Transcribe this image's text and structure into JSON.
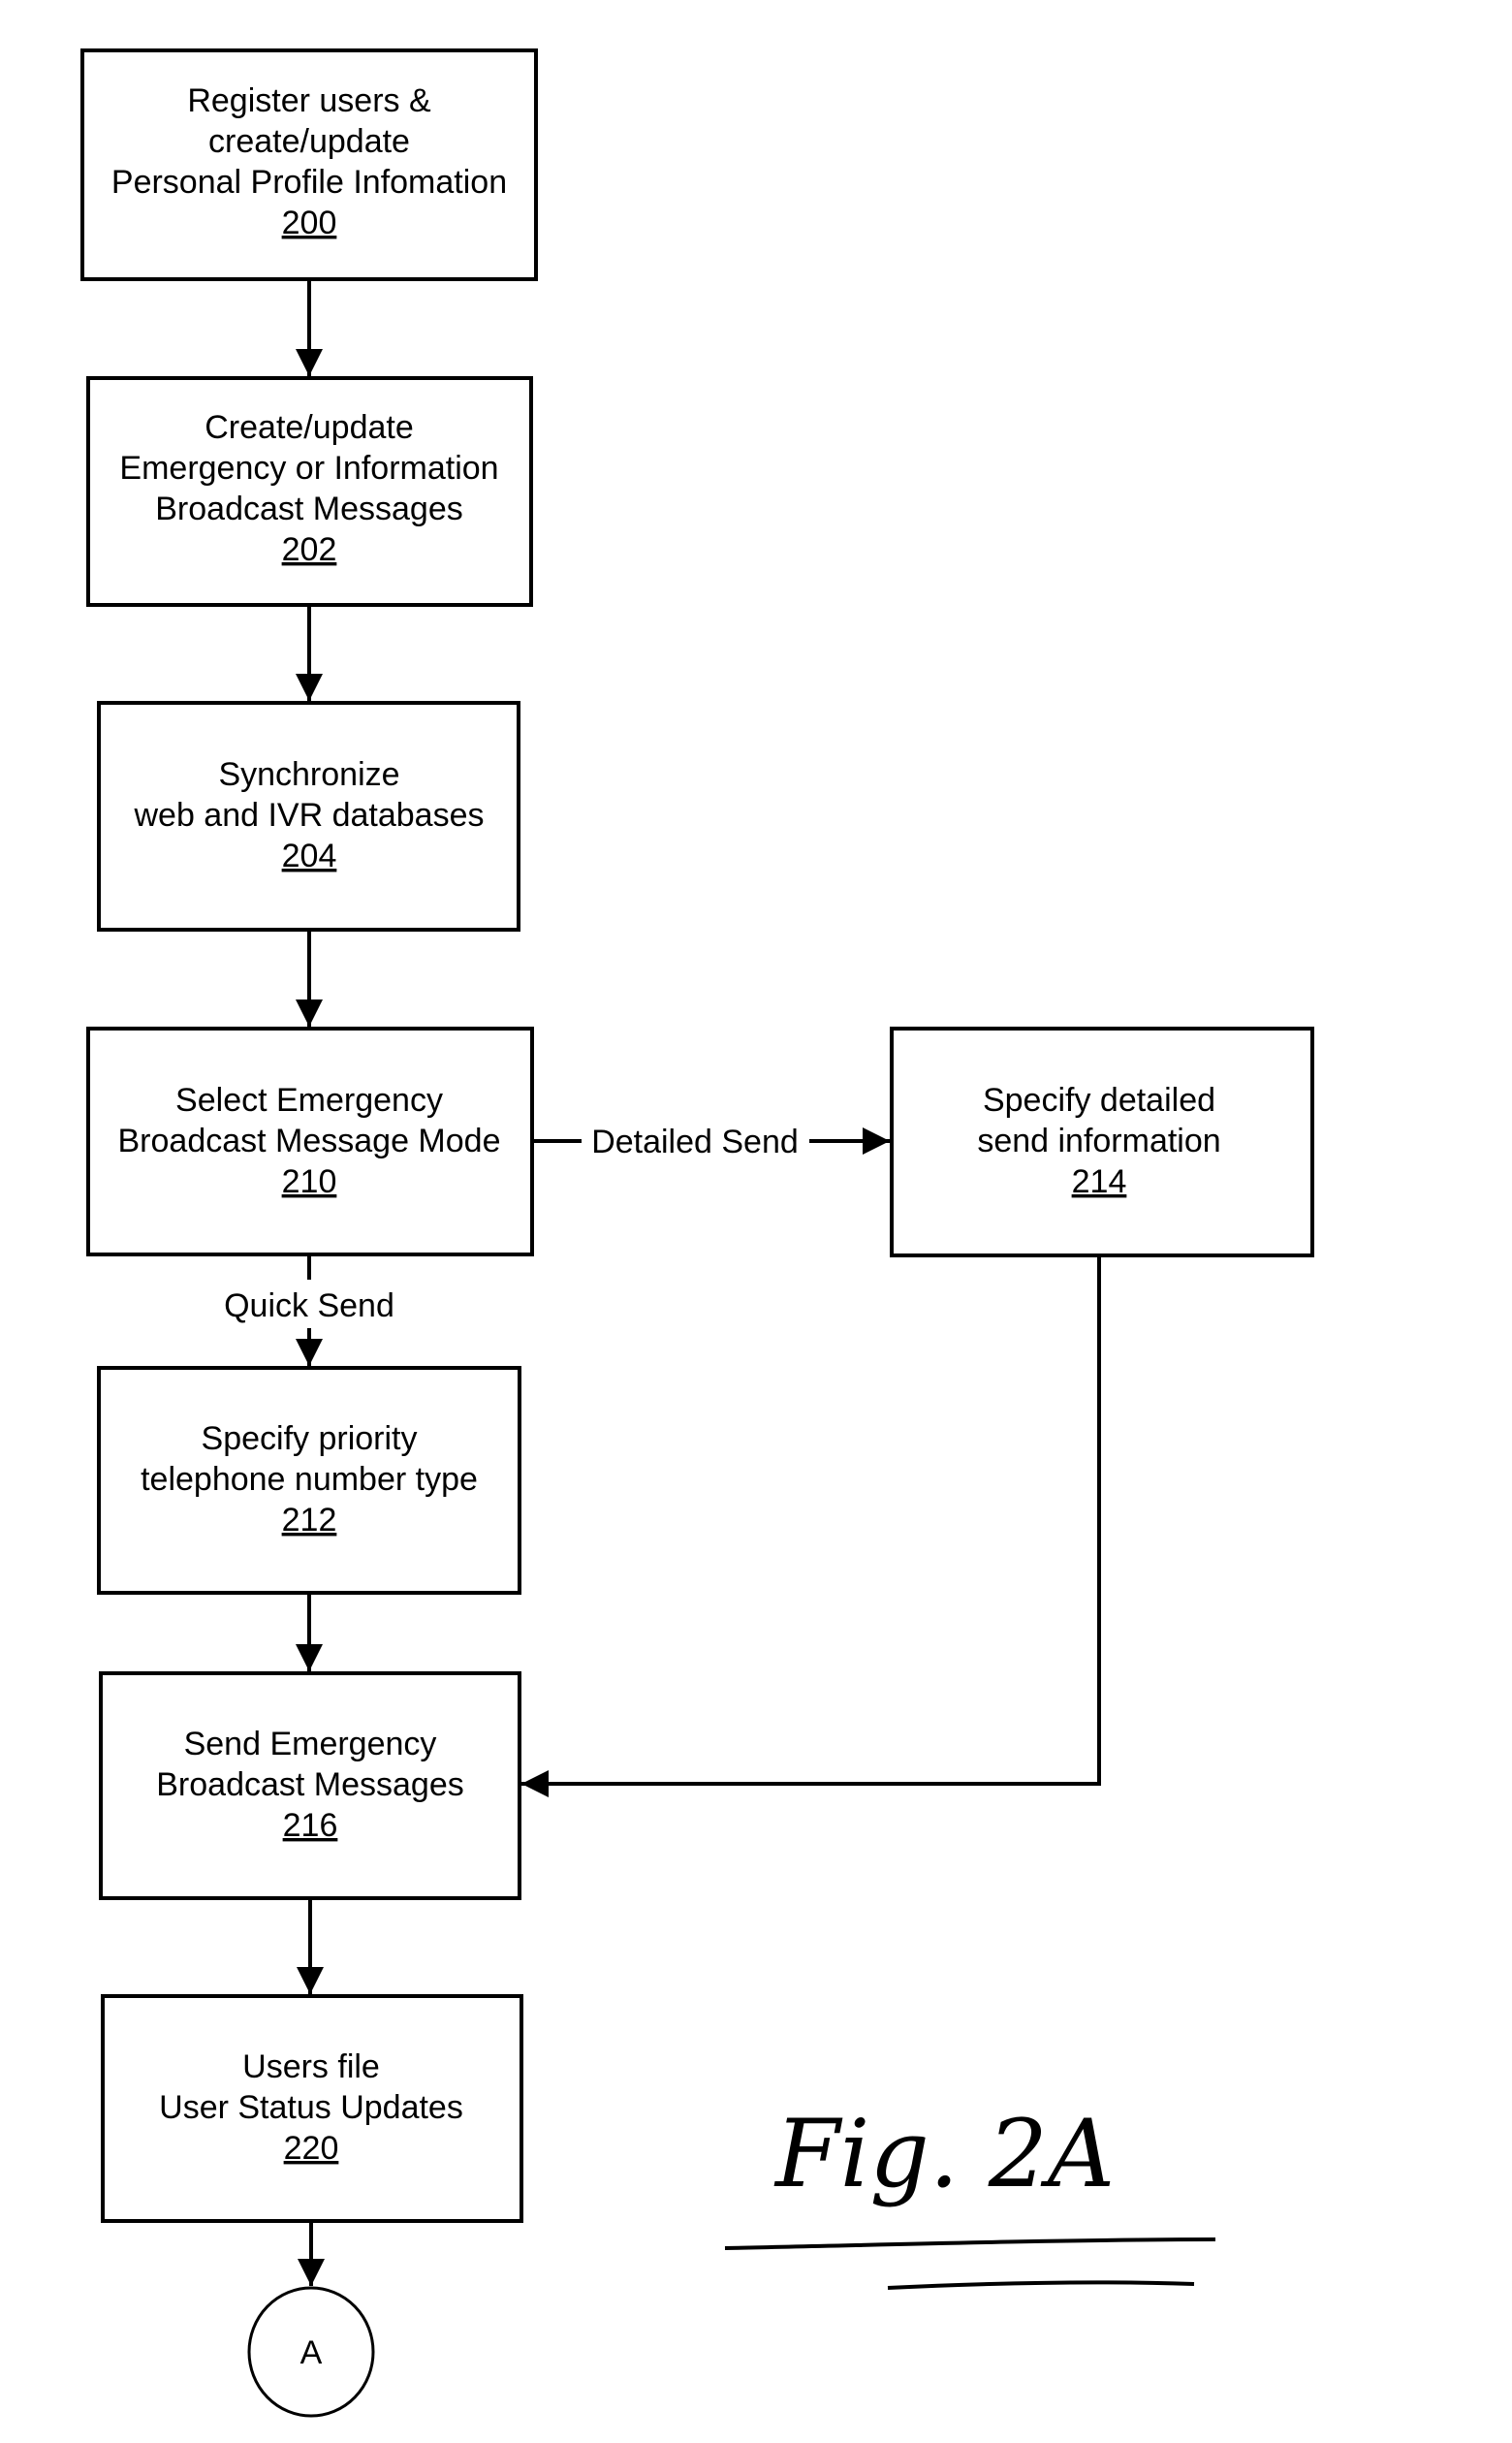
{
  "diagram": {
    "type": "flowchart",
    "figure_label": "Fig. 2A",
    "nodes": [
      {
        "id": "200",
        "lines": [
          "Register users &",
          "create/update",
          "Personal Profile Infomation"
        ],
        "ref": "200"
      },
      {
        "id": "202",
        "lines": [
          "Create/update",
          "Emergency or Information",
          "Broadcast Messages"
        ],
        "ref": "202"
      },
      {
        "id": "204",
        "lines": [
          "Synchronize",
          "web and IVR databases"
        ],
        "ref": "204"
      },
      {
        "id": "210",
        "lines": [
          "Select Emergency",
          "Broadcast Message Mode"
        ],
        "ref": "210"
      },
      {
        "id": "214",
        "lines": [
          "Specify detailed",
          "send information"
        ],
        "ref": "214"
      },
      {
        "id": "212",
        "lines": [
          "Specify priority",
          "telephone number type"
        ],
        "ref": "212"
      },
      {
        "id": "216",
        "lines": [
          "Send Emergency",
          "Broadcast Messages"
        ],
        "ref": "216"
      },
      {
        "id": "220",
        "lines": [
          "Users file",
          "User Status Updates"
        ],
        "ref": "220"
      }
    ],
    "connector": {
      "label": "A"
    },
    "edges": [
      {
        "from": "200",
        "to": "202",
        "label": ""
      },
      {
        "from": "202",
        "to": "204",
        "label": ""
      },
      {
        "from": "204",
        "to": "210",
        "label": ""
      },
      {
        "from": "210",
        "to": "214",
        "label": "Detailed Send"
      },
      {
        "from": "210",
        "to": "212",
        "label": "Quick Send"
      },
      {
        "from": "212",
        "to": "216",
        "label": ""
      },
      {
        "from": "214",
        "to": "216",
        "label": ""
      },
      {
        "from": "216",
        "to": "220",
        "label": ""
      },
      {
        "from": "220",
        "to": "A",
        "label": ""
      }
    ]
  }
}
